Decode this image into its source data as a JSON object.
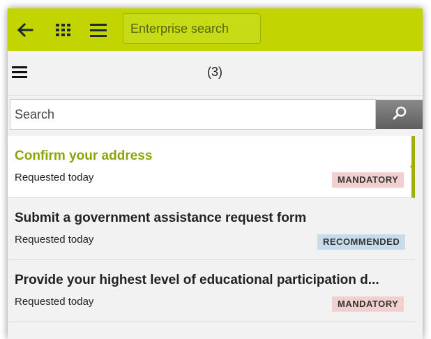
{
  "header": {
    "enterprise_search_placeholder": "Enterprise search",
    "icons": [
      "back-arrow-icon",
      "apps-grid-icon",
      "menu-icon"
    ]
  },
  "subheader": {
    "count": "(3)"
  },
  "search": {
    "placeholder": "Search"
  },
  "tasks": [
    {
      "title": "Confirm your address",
      "requested": "Requested today",
      "badge": "MANDATORY"
    },
    {
      "title": "Submit a government assistance request form",
      "requested": "Requested today",
      "badge": "RECOMMENDED"
    },
    {
      "title": "Provide your highest level of educational participation d...",
      "requested": "Requested today",
      "badge": "MANDATORY"
    }
  ],
  "colors": {
    "topbar": "#c2d500",
    "accent": "#8fa10b",
    "mandatory": "#f3d0d0",
    "recommended": "#c7dcea"
  }
}
